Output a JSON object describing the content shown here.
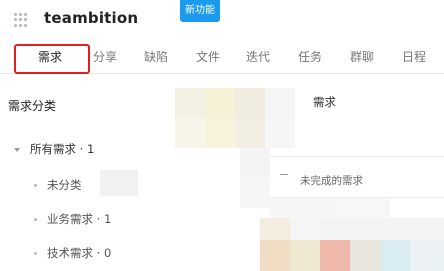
{
  "header": {
    "brand": "teambition",
    "new_badge": "新功能",
    "menu_icon": "grid-dots-icon"
  },
  "tabs": [
    {
      "label": "需求",
      "active": true
    },
    {
      "label": "分享",
      "active": false
    },
    {
      "label": "缺陷",
      "active": false
    },
    {
      "label": "文件",
      "active": false
    },
    {
      "label": "迭代",
      "active": false
    },
    {
      "label": "任务",
      "active": false
    },
    {
      "label": "群聊",
      "active": false
    },
    {
      "label": "日程",
      "active": false
    }
  ],
  "sidebar": {
    "title": "需求分类",
    "root": {
      "label": "所有需求 · 1"
    },
    "items": [
      {
        "label": "未分类"
      },
      {
        "label": "业务需求 · 1"
      },
      {
        "label": "技术需求 · 0"
      }
    ]
  },
  "main": {
    "title": "需求",
    "filter_label": "未完成的需求"
  },
  "colors": {
    "accent": "#1b9aee",
    "highlight": "#e02020"
  }
}
